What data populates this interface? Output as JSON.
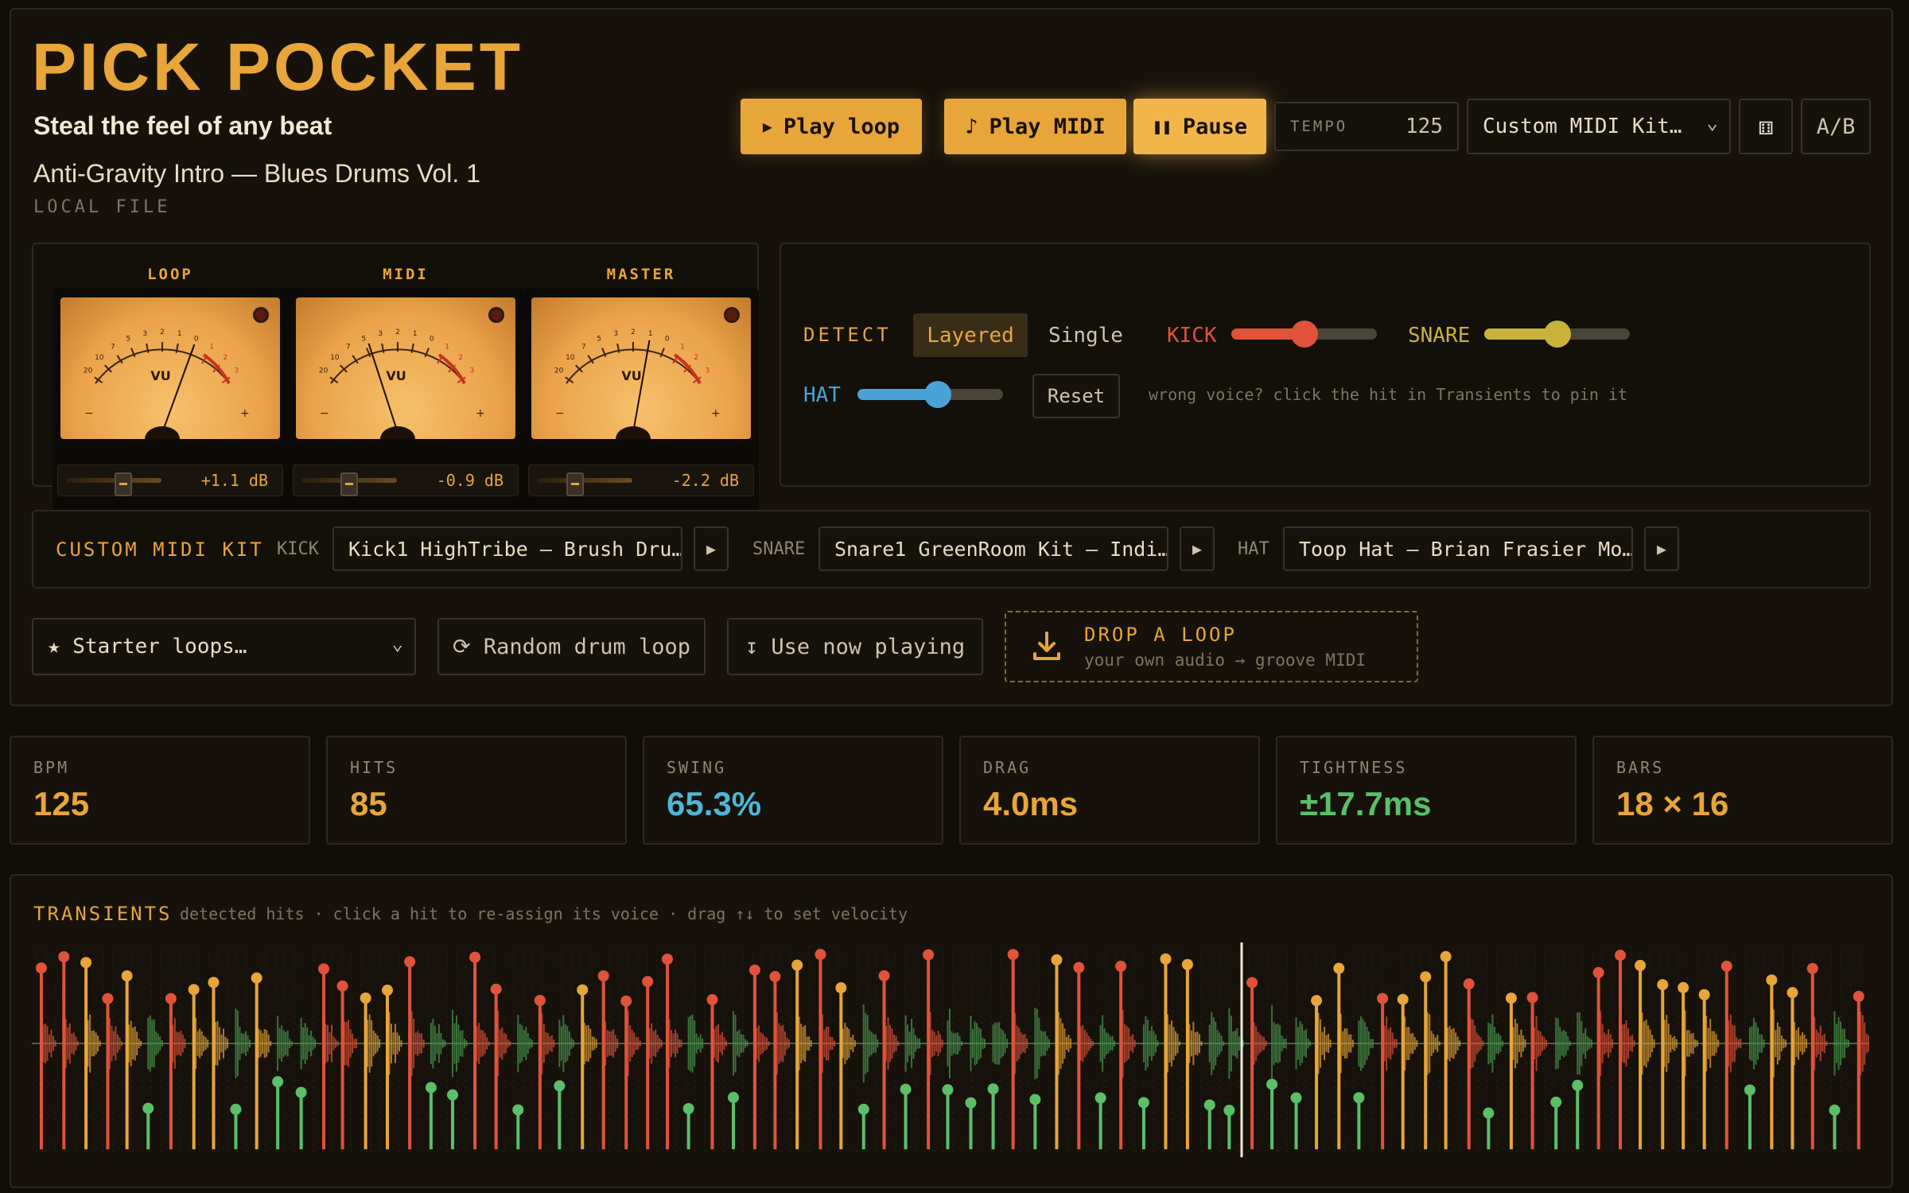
{
  "app": {
    "title": "PICK POCKET",
    "tagline": "Steal the feel of any beat",
    "track_title": "Anti-Gravity Intro — Blues Drums Vol. 1",
    "source": "LOCAL FILE"
  },
  "transport": {
    "play_loop": "Play loop",
    "play_midi": "Play MIDI",
    "pause": "Pause",
    "tempo_label": "TEMPO",
    "tempo_value": "125",
    "kit_select": "Custom MIDI Kit…",
    "ab_label": "A/B"
  },
  "meters": [
    {
      "name": "LOOP",
      "db": "+1.1 dB",
      "needle_deg": 20,
      "fader": 0.6
    },
    {
      "name": "MIDI",
      "db": "-0.9 dB",
      "needle_deg": -18,
      "fader": 0.5
    },
    {
      "name": "MASTER",
      "db": "-2.2 dB",
      "needle_deg": 10,
      "fader": 0.4
    }
  ],
  "meter_face": {
    "vu": "VU",
    "scale": [
      "20",
      "10",
      "7",
      "5",
      "3",
      "2",
      "1",
      "0",
      "1",
      "2",
      "3"
    ],
    "minus": "−",
    "plus": "+"
  },
  "detect": {
    "label": "DETECT",
    "modes": [
      "Layered",
      "Single"
    ],
    "active_mode": "Layered",
    "kick_label": "KICK",
    "kick_value": 0.5,
    "snare_label": "SNARE",
    "snare_value": 0.5,
    "hat_label": "HAT",
    "hat_value": 0.55,
    "reset": "Reset",
    "hint": "wrong voice? click the hit in Transients to pin it",
    "colors": {
      "kick": "#e0533a",
      "snare": "#c9b23a",
      "hat": "#4aa3d8"
    }
  },
  "kit": {
    "label": "CUSTOM MIDI KIT",
    "kick_label": "KICK",
    "kick_sample": "Kick1 HighTribe — Brush Dru…",
    "snare_label": "SNARE",
    "snare_sample": "Snare1 GreenRoom Kit — Indi…",
    "hat_label": "HAT",
    "hat_sample": "Toop Hat — Brian Frasier Mo…"
  },
  "sources": {
    "starter": "★ Starter loops…",
    "random": "⟳ Random drum loop",
    "now_playing": "↧ Use now playing",
    "drop_title": "DROP A LOOP",
    "drop_sub": "your own audio → groove MIDI"
  },
  "stats": [
    {
      "key": "BPM",
      "value": "125",
      "color": "#e8a53a"
    },
    {
      "key": "HITS",
      "value": "85",
      "color": "#e8a53a"
    },
    {
      "key": "SWING",
      "value": "65.3%",
      "color": "#4fb6d6"
    },
    {
      "key": "DRAG",
      "value": "4.0ms",
      "color": "#e8a53a"
    },
    {
      "key": "TIGHTNESS",
      "value": "±17.7ms",
      "color": "#5bbf6a"
    },
    {
      "key": "BARS",
      "value": "18 × 16",
      "color": "#e8a53a"
    }
  ],
  "transients": {
    "title": "TRANSIENTS",
    "hint": "detected hits · click a hit to re-assign its voice · drag ↑↓ to set velocity",
    "colors": {
      "kick": "#5bbf6a",
      "snare": "#e0533a",
      "hat": "#e8a53a"
    }
  }
}
